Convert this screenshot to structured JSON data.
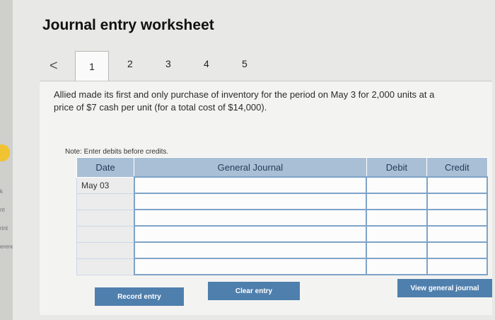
{
  "sidebar": {
    "labels": [
      "k",
      "nt",
      "rint",
      "erences"
    ]
  },
  "worksheet": {
    "title": "Journal entry worksheet",
    "tabs": [
      "1",
      "2",
      "3",
      "4",
      "5"
    ],
    "prev_arrow": "<",
    "prompt": "Allied made its first and only purchase of inventory for the period on May 3 for 2,000 units at a price of $7 cash per unit (for a total cost of $14,000).",
    "note": "Note: Enter debits before credits."
  },
  "table": {
    "headers": [
      "Date",
      "General Journal",
      "Debit",
      "Credit"
    ],
    "rows": [
      {
        "date": "May 03"
      },
      {
        "date": ""
      },
      {
        "date": ""
      },
      {
        "date": ""
      },
      {
        "date": ""
      },
      {
        "date": ""
      }
    ]
  },
  "buttons": {
    "record": "Record entry",
    "clear": "Clear entry",
    "view": "View general journal"
  }
}
